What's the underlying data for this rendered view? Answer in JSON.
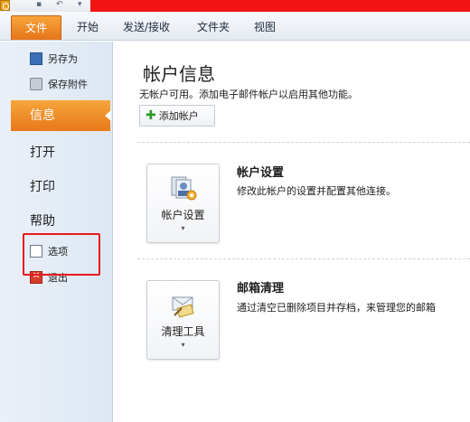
{
  "quick_access": {
    "undo_glyph": "↶",
    "more_glyph": "▾"
  },
  "ribbon": {
    "tabs": [
      {
        "label": "文件"
      },
      {
        "label": "开始"
      },
      {
        "label": "发送/接收"
      },
      {
        "label": "文件夹"
      },
      {
        "label": "视图"
      }
    ]
  },
  "nav": {
    "save_as": "另存为",
    "save_attachments": "保存附件",
    "info": "信息",
    "open": "打开",
    "print": "打印",
    "help": "帮助",
    "options": "选项",
    "exit": "退出"
  },
  "main": {
    "title": "帐户信息",
    "subtitle": "无帐户可用。添加电子邮件帐户以启用其他功能。",
    "add_account": "添加帐户",
    "account_settings": {
      "button_label": "帐户设置",
      "title": "帐户设置",
      "description": "修改此帐户的设置并配置其他连接。"
    },
    "mailbox_cleanup": {
      "button_label": "清理工具",
      "title": "邮箱清理",
      "description": "通过清空已删除项目并存档，来管理您的邮箱"
    },
    "dropdown_glyph": "▾"
  },
  "colors": {
    "accent_orange": "#e8781b",
    "highlight_red": "#e8191e",
    "title_bar_red": "#f01414"
  }
}
